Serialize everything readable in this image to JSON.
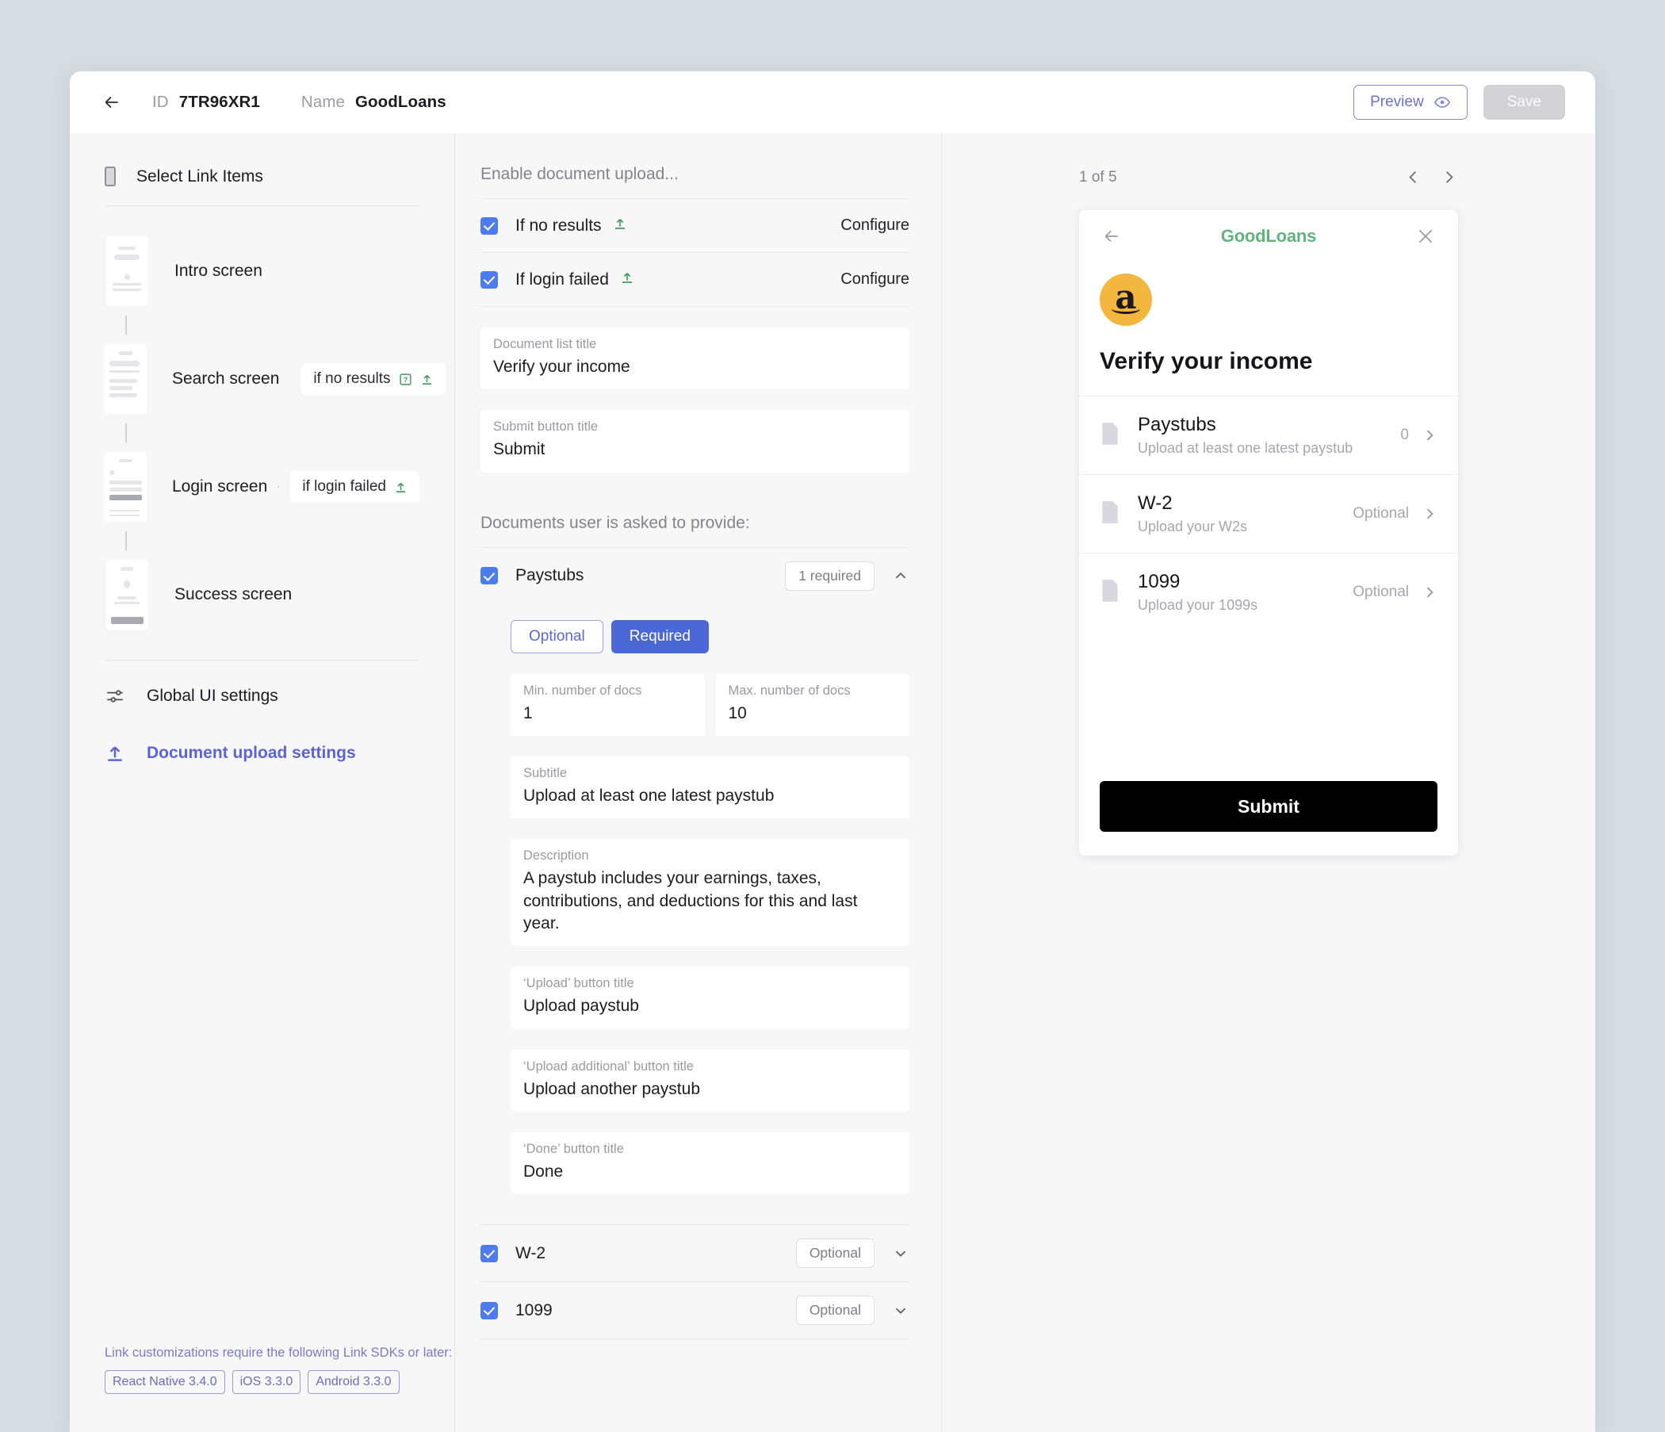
{
  "header": {
    "back_icon": "arrow-left-icon",
    "id_label": "ID",
    "id_value": "7TR96XR1",
    "name_label": "Name",
    "name_value": "GoodLoans",
    "preview_label": "Preview",
    "preview_icon": "eye-icon",
    "save_label": "Save"
  },
  "sidebar": {
    "head_title": "Select Link Items",
    "head_icon": "phone-icon",
    "screens": [
      {
        "label": "Intro screen",
        "chip": null
      },
      {
        "label": "Search screen",
        "chip": "if no results",
        "chip_icons": [
          "question-box-icon",
          "upload-icon"
        ]
      },
      {
        "label": "Login screen",
        "chip": "if login failed",
        "chip_icons": [
          "upload-icon"
        ]
      },
      {
        "label": "Success screen",
        "chip": null
      }
    ],
    "settings": [
      {
        "label": "Global UI settings",
        "icon": "sliders-icon",
        "active": false
      },
      {
        "label": "Document upload settings",
        "icon": "upload-icon",
        "active": true
      }
    ],
    "sdk_note": "Link customizations require the following Link SDKs or later:",
    "sdk_badges": [
      "React Native 3.4.0",
      "iOS 3.3.0",
      "Android 3.3.0"
    ]
  },
  "center": {
    "enable_section_title": "Enable document upload...",
    "triggers": [
      {
        "label": "If no results",
        "icon": "upload-icon",
        "checked": true,
        "action": "Configure"
      },
      {
        "label": "If login failed",
        "icon": "upload-icon",
        "checked": true,
        "action": "Configure"
      }
    ],
    "doc_list_title": {
      "label": "Document list title",
      "value": "Verify your income"
    },
    "submit_button_title": {
      "label": "Submit button title",
      "value": "Submit"
    },
    "documents_section_title": "Documents user is asked to provide:",
    "paystubs": {
      "name": "Paystubs",
      "checked": true,
      "badge": "1 required",
      "chevron": "chevron-up-icon",
      "segments": {
        "optional": "Optional",
        "required": "Required",
        "selected": "Required"
      },
      "min_docs": {
        "label": "Min. number of docs",
        "value": "1"
      },
      "max_docs": {
        "label": "Max. number of docs",
        "value": "10"
      },
      "subtitle": {
        "label": "Subtitle",
        "value": "Upload at least one latest paystub"
      },
      "description": {
        "label": "Description",
        "value": "A paystub includes your earnings, taxes, contributions, and deductions for this and last year."
      },
      "upload_btn": {
        "label": "‘Upload’ button title",
        "value": "Upload paystub"
      },
      "upload_more_btn": {
        "label": "‘Upload additional’ button title",
        "value": "Upload another paystub"
      },
      "done_btn": {
        "label": "‘Done’ button title",
        "value": "Done"
      }
    },
    "other_docs": [
      {
        "name": "W-2",
        "checked": true,
        "badge": "Optional",
        "chevron": "chevron-down-icon"
      },
      {
        "name": "1099",
        "checked": true,
        "badge": "Optional",
        "chevron": "chevron-down-icon"
      }
    ]
  },
  "preview": {
    "counter": "1 of 5",
    "prev_icon": "chevron-left-icon",
    "next_icon": "chevron-right-icon",
    "phone": {
      "back_icon": "arrow-left-icon",
      "brand": "GoodLoans",
      "close_icon": "close-icon",
      "logo": {
        "name": "amazon-logo",
        "letter": "a",
        "color": "#f3b63f"
      },
      "title": "Verify your income",
      "items": [
        {
          "title": "Paystubs",
          "subtitle": "Upload at least one latest paystub",
          "meta": "0"
        },
        {
          "title": "W-2",
          "subtitle": "Upload your W2s",
          "meta": "Optional"
        },
        {
          "title": "1099",
          "subtitle": "Upload your 1099s",
          "meta": "Optional"
        }
      ],
      "submit_label": "Submit"
    }
  },
  "colors": {
    "accent_indigo": "#5b64d4",
    "checkbox_blue": "#4c7ced",
    "segment_blue": "#4c68d7",
    "brand_green": "#63b37e",
    "upload_green": "#3f9a5a",
    "amazon_orange": "#f3b63f"
  }
}
